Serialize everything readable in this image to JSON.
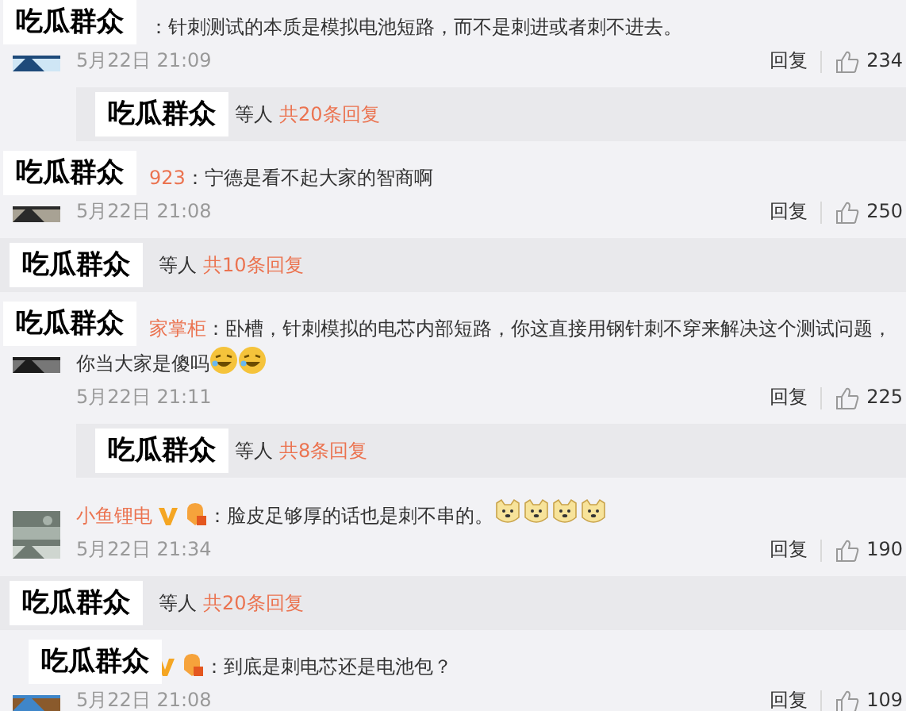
{
  "items": [
    {
      "kind": "comment",
      "sticker": "吃瓜群众",
      "text": "：针刺测试的本质是模拟电池短路，而不是刺进或者刺不进去。",
      "date": "5月22日 21:09",
      "reply": "回复",
      "likes": "234"
    },
    {
      "kind": "replies",
      "indented": true,
      "sticker": "吃瓜群众",
      "suffix": "等人",
      "link": "共20条回复"
    },
    {
      "kind": "comment",
      "sticker": "吃瓜群众",
      "username": "923",
      "text": "：宁德是看不起大家的智商啊",
      "date": "5月22日 21:08",
      "reply": "回复",
      "likes": "250"
    },
    {
      "kind": "replies",
      "indented": false,
      "sticker": "吃瓜群众",
      "suffix": "等人",
      "link": "共10条回复"
    },
    {
      "kind": "comment",
      "sticker": "吃瓜群众",
      "username": "家掌柜",
      "text": "：卧槽，针刺模拟的电芯内部短路，你这直接用钢针刺不穿来解决这个测试问题，你当大家是傻吗",
      "emoji": [
        {
          "kind": "laughing"
        },
        {
          "kind": "laughing"
        }
      ],
      "date": "5月22日 21:11",
      "reply": "回复",
      "likes": "225"
    },
    {
      "kind": "replies",
      "indented": true,
      "sticker": "吃瓜群众",
      "suffix": "等人",
      "link": "共8条回复"
    },
    {
      "kind": "comment",
      "username": "小鱼锂电",
      "verified": true,
      "badge": true,
      "text": "：脸皮足够厚的话也是刺不串的。",
      "emoji": [
        {
          "kind": "dog"
        },
        {
          "kind": "dog"
        },
        {
          "kind": "dog"
        },
        {
          "kind": "dog"
        }
      ],
      "date": "5月22日 21:34",
      "reply": "回复",
      "likes": "190"
    },
    {
      "kind": "replies",
      "indented": false,
      "sticker": "吃瓜群众",
      "suffix": "等人",
      "link": "共20条回复"
    },
    {
      "kind": "comment",
      "sticker": "吃瓜群众",
      "verified": true,
      "badge": true,
      "text": "：到底是刺电芯还是电池包？",
      "date": "5月22日 21:08",
      "reply": "回复",
      "likes": "109"
    }
  ]
}
